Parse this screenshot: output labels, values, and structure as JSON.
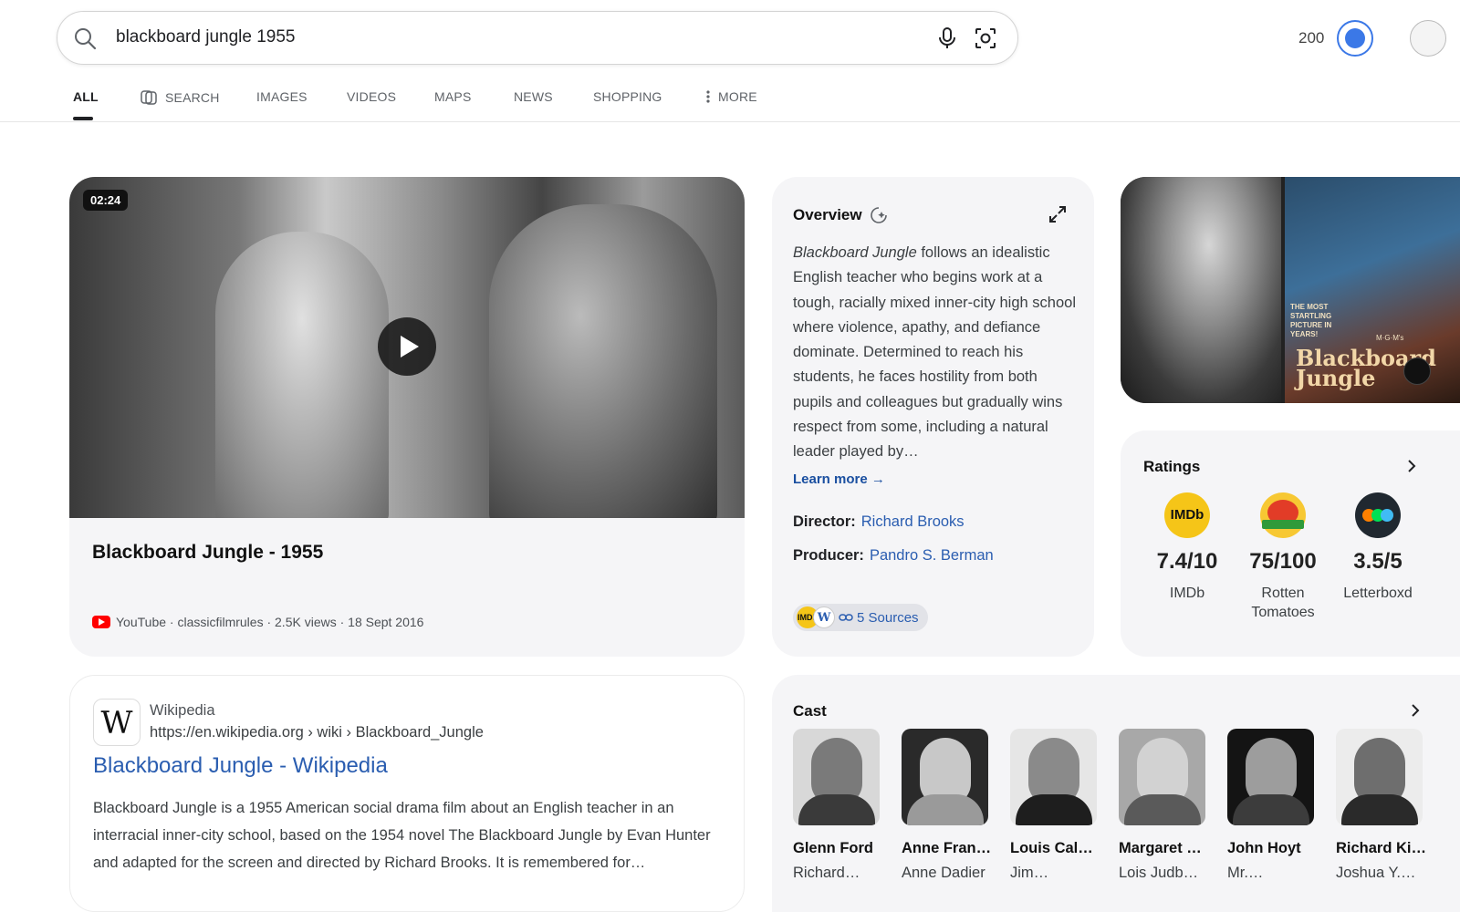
{
  "search": {
    "query": "blackboard jungle 1955"
  },
  "header": {
    "points": "200"
  },
  "tabs": [
    {
      "label": "ALL"
    },
    {
      "label": "SEARCH"
    },
    {
      "label": "IMAGES"
    },
    {
      "label": "VIDEOS"
    },
    {
      "label": "MAPS"
    },
    {
      "label": "NEWS"
    },
    {
      "label": "SHOPPING"
    },
    {
      "label": "MORE"
    }
  ],
  "video": {
    "duration": "02:24",
    "title": "Blackboard Jungle - 1955",
    "meta": "YouTube · classicfilmrules · 2.5K views · 18 Sept 2016"
  },
  "overview": {
    "title": "Overview",
    "text_italic": "Blackboard Jungle",
    "text_rest": " follows an idealistic English teacher who begins work at a tough, racially mixed inner-city high school where violence, apathy, and defiance dominate. Determined to reach his students, he faces hostility from both pupils and colleagues but gradually wins respect from some, including a natural leader played by…",
    "learn_more": "Learn more →",
    "director_label": "Director:",
    "director": "Richard Brooks",
    "producer_label": "Producer:",
    "producer": "Pandro S. Berman",
    "sources": "5 Sources"
  },
  "images": {
    "poster_tag": "THE MOST STARTLING PICTURE IN YEARS!",
    "poster_studio": "M·G·M's",
    "poster_title": "Blackboard Jungle"
  },
  "ratings": {
    "title": "Ratings",
    "items": [
      {
        "logo": "IMDb",
        "score": "7.4/10",
        "source": "IMDb"
      },
      {
        "logo": "tomato",
        "score": "75/100",
        "source": "Rotten Tomatoes"
      },
      {
        "logo": "dots",
        "score": "3.5/5",
        "source": "Letterboxd"
      }
    ]
  },
  "wiki": {
    "site": "Wikipedia",
    "url": "https://en.wikipedia.org › wiki › Blackboard_Jungle",
    "title": "Blackboard Jungle - Wikipedia",
    "description": "Blackboard Jungle is a 1955 American social drama film about an English teacher in an interracial inner-city school, based on the 1954 novel The Blackboard Jungle by Evan Hunter and adapted for the screen and directed by Richard Brooks. It is remembered for…"
  },
  "cast": {
    "title": "Cast",
    "actors": [
      {
        "name": "Glenn Ford",
        "role": "Richard…"
      },
      {
        "name": "Anne Fran…",
        "role": "Anne Dadier"
      },
      {
        "name": "Louis Cal…",
        "role": "Jim…"
      },
      {
        "name": "Margaret …",
        "role": "Lois Judb…"
      },
      {
        "name": "John Hoyt",
        "role": "Mr.…"
      },
      {
        "name": "Richard Ki…",
        "role": "Joshua Y.…"
      }
    ]
  },
  "colors": {
    "link": "#2a5db0",
    "accent": "#3b78e7",
    "youtube": "#ff0000",
    "imdb": "#f5c518"
  }
}
